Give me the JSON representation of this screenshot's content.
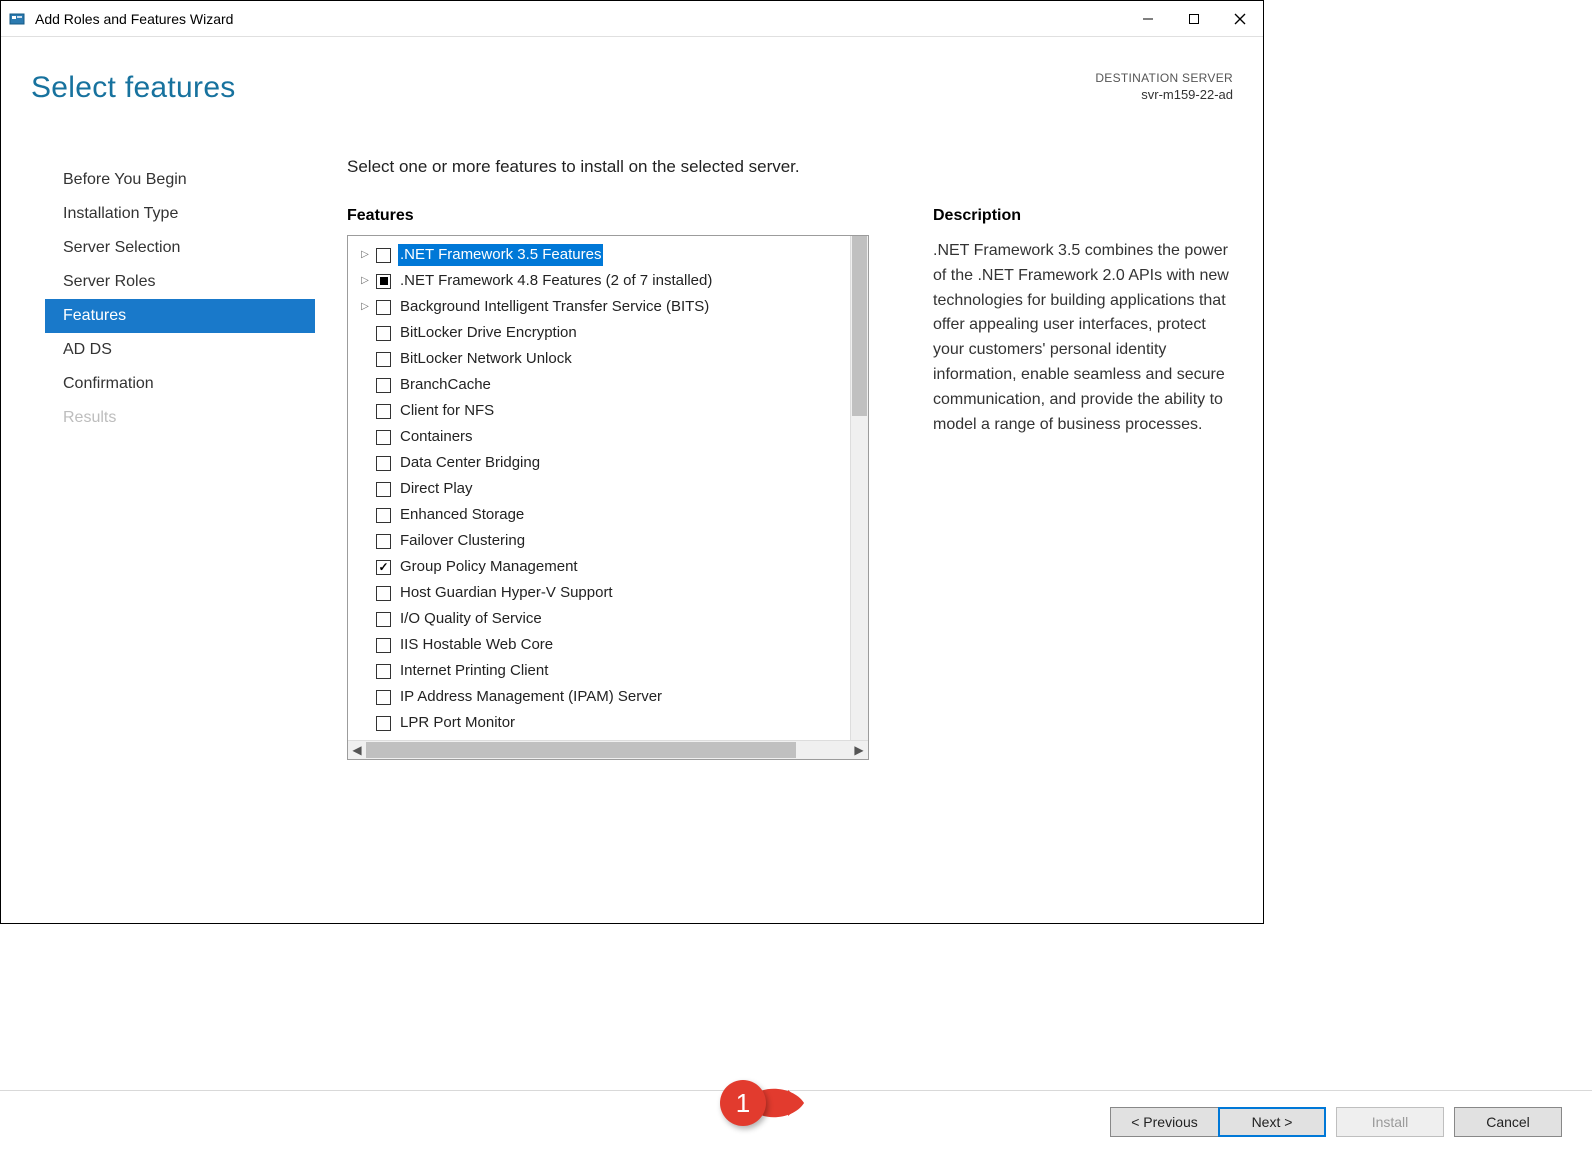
{
  "window": {
    "title": "Add Roles and Features Wizard"
  },
  "header": {
    "page_title": "Select features",
    "dest_label": "DESTINATION SERVER",
    "dest_value": "svr-m159-22-ad"
  },
  "sidebar": {
    "items": [
      {
        "label": "Before You Begin",
        "state": "normal"
      },
      {
        "label": "Installation Type",
        "state": "normal"
      },
      {
        "label": "Server Selection",
        "state": "normal"
      },
      {
        "label": "Server Roles",
        "state": "normal"
      },
      {
        "label": "Features",
        "state": "active"
      },
      {
        "label": "AD DS",
        "state": "normal"
      },
      {
        "label": "Confirmation",
        "state": "normal"
      },
      {
        "label": "Results",
        "state": "disabled"
      }
    ]
  },
  "main": {
    "instruction": "Select one or more features to install on the selected server.",
    "features_label": "Features",
    "description_label": "Description",
    "description_text": ".NET Framework 3.5 combines the power of the .NET Framework 2.0 APIs with new technologies for building applications that offer appealing user interfaces, protect your customers' personal identity information, enable seamless and secure communication, and provide the ability to model a range of business processes.",
    "features": [
      {
        "label": ".NET Framework 3.5 Features",
        "expandable": true,
        "check": "none",
        "selected": true
      },
      {
        "label": ".NET Framework 4.8 Features (2 of 7 installed)",
        "expandable": true,
        "check": "partial"
      },
      {
        "label": "Background Intelligent Transfer Service (BITS)",
        "expandable": true,
        "check": "none"
      },
      {
        "label": "BitLocker Drive Encryption",
        "expandable": false,
        "check": "none"
      },
      {
        "label": "BitLocker Network Unlock",
        "expandable": false,
        "check": "none"
      },
      {
        "label": "BranchCache",
        "expandable": false,
        "check": "none"
      },
      {
        "label": "Client for NFS",
        "expandable": false,
        "check": "none"
      },
      {
        "label": "Containers",
        "expandable": false,
        "check": "none"
      },
      {
        "label": "Data Center Bridging",
        "expandable": false,
        "check": "none"
      },
      {
        "label": "Direct Play",
        "expandable": false,
        "check": "none"
      },
      {
        "label": "Enhanced Storage",
        "expandable": false,
        "check": "none"
      },
      {
        "label": "Failover Clustering",
        "expandable": false,
        "check": "none"
      },
      {
        "label": "Group Policy Management",
        "expandable": false,
        "check": "checked"
      },
      {
        "label": "Host Guardian Hyper-V Support",
        "expandable": false,
        "check": "none"
      },
      {
        "label": "I/O Quality of Service",
        "expandable": false,
        "check": "none"
      },
      {
        "label": "IIS Hostable Web Core",
        "expandable": false,
        "check": "none"
      },
      {
        "label": "Internet Printing Client",
        "expandable": false,
        "check": "none"
      },
      {
        "label": "IP Address Management (IPAM) Server",
        "expandable": false,
        "check": "none"
      },
      {
        "label": "LPR Port Monitor",
        "expandable": false,
        "check": "none"
      }
    ]
  },
  "footer": {
    "previous": "< Previous",
    "next": "Next >",
    "install": "Install",
    "cancel": "Cancel"
  },
  "callout": {
    "number": "1"
  }
}
